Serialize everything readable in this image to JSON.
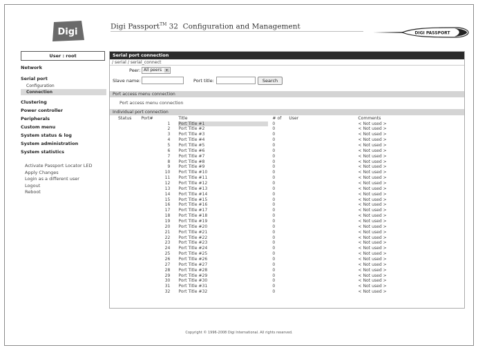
{
  "header": {
    "logo_text": "Digi",
    "title_prefix": "Digi Passport",
    "title_tm": "TM",
    "title_rest": " 32  Configuration and Management",
    "brand_text": "DIGI PASSPORT"
  },
  "user": {
    "label": "User : root"
  },
  "sidebar": {
    "items": [
      {
        "label": "Network"
      },
      {
        "label": "Serial port"
      },
      {
        "label": "Configuration"
      },
      {
        "label": "Connection"
      },
      {
        "label": "Clustering"
      },
      {
        "label": "Power controller"
      },
      {
        "label": "Peripherals"
      },
      {
        "label": "Custom menu"
      },
      {
        "label": "System status & log"
      },
      {
        "label": "System administration"
      },
      {
        "label": "System statistics"
      }
    ],
    "actions": [
      {
        "label": "Activate Passport Locator LED"
      },
      {
        "label": "Apply Changes"
      },
      {
        "label": "Login as a different user"
      },
      {
        "label": "Logout"
      },
      {
        "label": "Reboot"
      }
    ]
  },
  "main": {
    "panel_title": "Serial port connection",
    "breadcrumb": "/ serial / serial_connect",
    "peer_label": "Peer:",
    "peer_value": "All peers",
    "slave_label": "Slave name:",
    "slave_value": "",
    "port_title_label": "Port title:",
    "port_title_value": "",
    "search_button": "Search",
    "section1_title": "Port access menu connection",
    "section1_link": "Port access menu connection",
    "section2_title": "Individual port connection",
    "columns": {
      "status": "Status",
      "port": "Port#",
      "title": "Title",
      "num": "# of",
      "user": "User",
      "comments": "Comments"
    },
    "rows": [
      {
        "port": "1",
        "title": "Port Title #1",
        "num": "0",
        "comment": "< Not used >"
      },
      {
        "port": "2",
        "title": "Port Title #2",
        "num": "0",
        "comment": "< Not used >"
      },
      {
        "port": "3",
        "title": "Port Title #3",
        "num": "0",
        "comment": "< Not used >"
      },
      {
        "port": "4",
        "title": "Port Title #4",
        "num": "0",
        "comment": "< Not used >"
      },
      {
        "port": "5",
        "title": "Port Title #5",
        "num": "0",
        "comment": "< Not used >"
      },
      {
        "port": "6",
        "title": "Port Title #6",
        "num": "0",
        "comment": "< Not used >"
      },
      {
        "port": "7",
        "title": "Port Title #7",
        "num": "0",
        "comment": "< Not used >"
      },
      {
        "port": "8",
        "title": "Port Title #8",
        "num": "0",
        "comment": "< Not used >"
      },
      {
        "port": "9",
        "title": "Port Title #9",
        "num": "0",
        "comment": "< Not used >"
      },
      {
        "port": "10",
        "title": "Port Title #10",
        "num": "0",
        "comment": "< Not used >"
      },
      {
        "port": "11",
        "title": "Port Title #11",
        "num": "0",
        "comment": "< Not used >"
      },
      {
        "port": "12",
        "title": "Port Title #12",
        "num": "0",
        "comment": "< Not used >"
      },
      {
        "port": "13",
        "title": "Port Title #13",
        "num": "0",
        "comment": "< Not used >"
      },
      {
        "port": "14",
        "title": "Port Title #14",
        "num": "0",
        "comment": "< Not used >"
      },
      {
        "port": "15",
        "title": "Port Title #15",
        "num": "0",
        "comment": "< Not used >"
      },
      {
        "port": "16",
        "title": "Port Title #16",
        "num": "0",
        "comment": "< Not used >"
      },
      {
        "port": "17",
        "title": "Port Title #17",
        "num": "0",
        "comment": "< Not used >"
      },
      {
        "port": "18",
        "title": "Port Title #18",
        "num": "0",
        "comment": "< Not used >"
      },
      {
        "port": "19",
        "title": "Port Title #19",
        "num": "0",
        "comment": "< Not used >"
      },
      {
        "port": "20",
        "title": "Port Title #20",
        "num": "0",
        "comment": "< Not used >"
      },
      {
        "port": "21",
        "title": "Port Title #21",
        "num": "0",
        "comment": "< Not used >"
      },
      {
        "port": "22",
        "title": "Port Title #22",
        "num": "0",
        "comment": "< Not used >"
      },
      {
        "port": "23",
        "title": "Port Title #23",
        "num": "0",
        "comment": "< Not used >"
      },
      {
        "port": "24",
        "title": "Port Title #24",
        "num": "0",
        "comment": "< Not used >"
      },
      {
        "port": "25",
        "title": "Port Title #25",
        "num": "0",
        "comment": "< Not used >"
      },
      {
        "port": "26",
        "title": "Port Title #26",
        "num": "0",
        "comment": "< Not used >"
      },
      {
        "port": "27",
        "title": "Port Title #27",
        "num": "0",
        "comment": "< Not used >"
      },
      {
        "port": "28",
        "title": "Port Title #28",
        "num": "0",
        "comment": "< Not used >"
      },
      {
        "port": "29",
        "title": "Port Title #29",
        "num": "0",
        "comment": "< Not used >"
      },
      {
        "port": "30",
        "title": "Port Title #30",
        "num": "0",
        "comment": "< Not used >"
      },
      {
        "port": "31",
        "title": "Port Title #31",
        "num": "0",
        "comment": "< Not used >"
      },
      {
        "port": "32",
        "title": "Port Title #32",
        "num": "0",
        "comment": "< Not used >"
      }
    ]
  },
  "footer": {
    "copyright": "Copyright © 1996-2008 Digi International. All rights reserved."
  },
  "colors": {
    "panel_header": "#2b2b2b",
    "section_bar": "#d4d4d4",
    "active_nav": "#d8d8d8"
  }
}
